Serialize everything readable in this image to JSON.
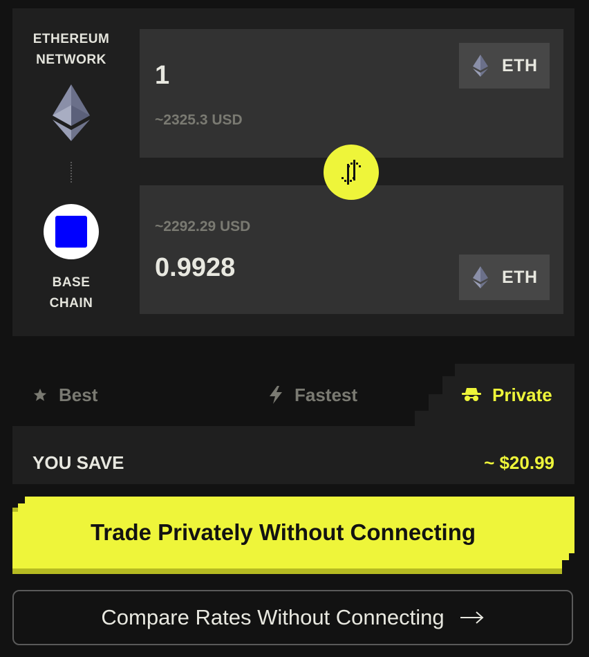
{
  "networks": {
    "from": {
      "line1": "ETHEREUM",
      "line2": "NETWORK",
      "icon": "ethereum-logo-icon"
    },
    "to": {
      "line1": "BASE",
      "line2": "CHAIN",
      "icon": "base-logo-icon"
    }
  },
  "send": {
    "amount": "1",
    "usd": "~2325.3 USD",
    "token": "ETH"
  },
  "receive": {
    "amount": "0.9928",
    "usd": "~2292.29 USD",
    "token": "ETH"
  },
  "swap_icon": "swap-arrows-icon",
  "tabs": [
    {
      "label": "Best",
      "icon": "star-icon"
    },
    {
      "label": "Fastest",
      "icon": "lightning-icon"
    },
    {
      "label": "Private",
      "icon": "spy-icon",
      "selected": true
    }
  ],
  "savings": {
    "label": "YOU SAVE",
    "value": "~ $20.99"
  },
  "cta": {
    "label": "Trade Privately Without Connecting"
  },
  "compare": {
    "label": "Compare Rates Without Connecting",
    "icon": "arrow-right-icon"
  },
  "colors": {
    "accent": "#eef53a",
    "panel": "#1f1f1f",
    "input": "#323232",
    "background": "#121212"
  }
}
